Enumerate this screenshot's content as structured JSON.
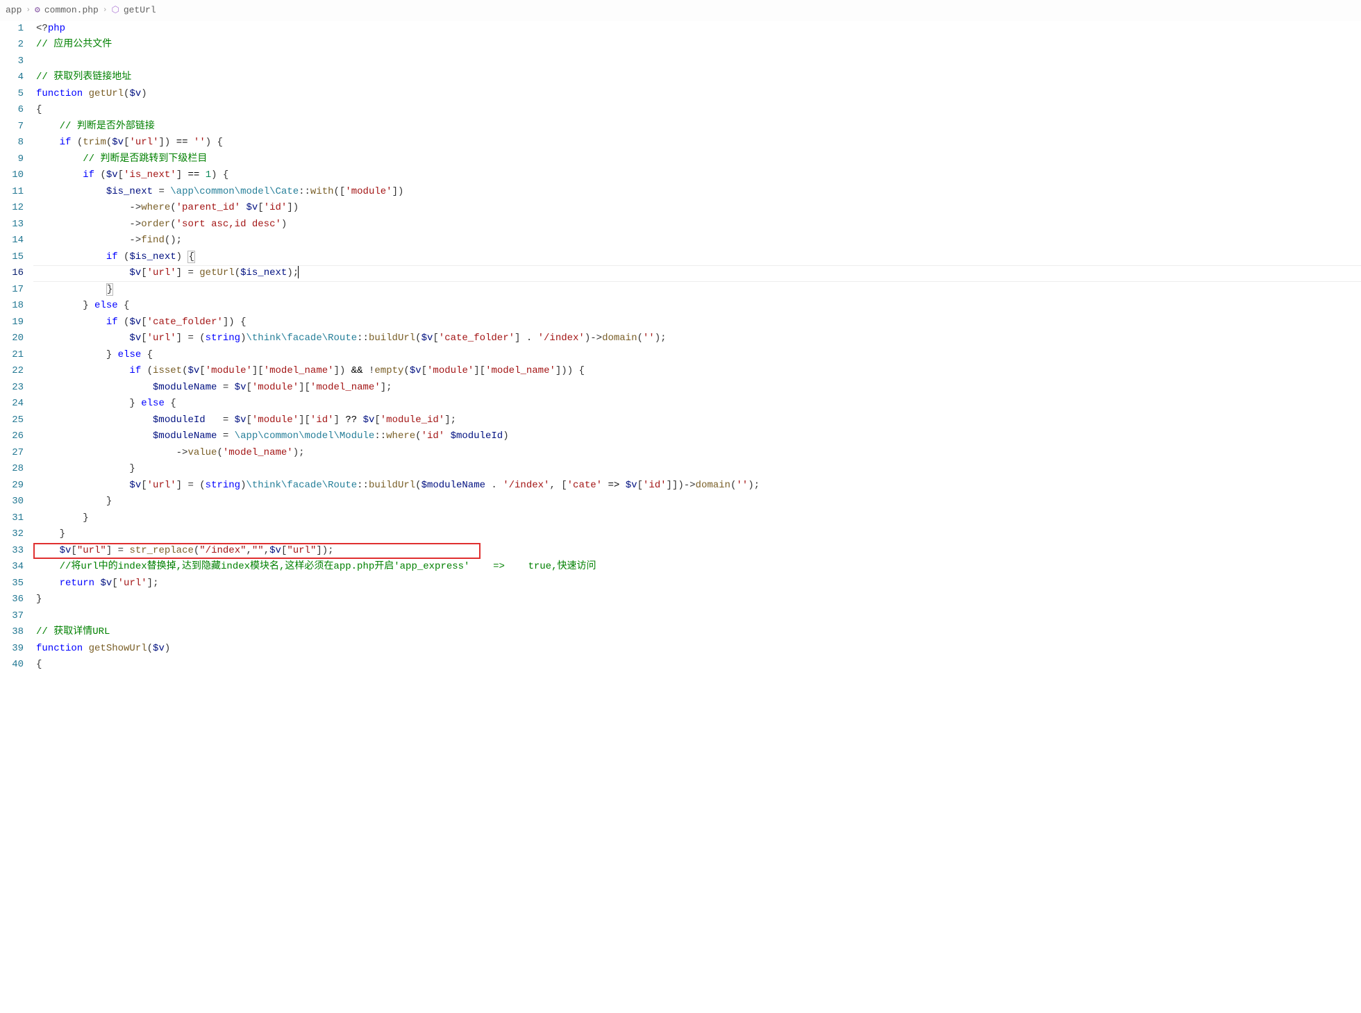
{
  "breadcrumb": {
    "root": "app",
    "file": "common.php",
    "symbol": "getUrl"
  },
  "active_line": 16,
  "highlighted_line": 33,
  "lines": [
    {
      "n": 1,
      "tokens": [
        [
          "tok-delim",
          "<?"
        ],
        [
          "tok-kw",
          "php"
        ]
      ]
    },
    {
      "n": 2,
      "tokens": [
        [
          "tok-cmt",
          "// 应用公共文件"
        ]
      ]
    },
    {
      "n": 3,
      "tokens": []
    },
    {
      "n": 4,
      "tokens": [
        [
          "tok-cmt",
          "// 获取列表链接地址"
        ]
      ]
    },
    {
      "n": 5,
      "tokens": [
        [
          "tok-kw",
          "function"
        ],
        [
          "",
          ", "
        ],
        [
          "tok-fn",
          "getUrl"
        ],
        [
          "tok-delim",
          "("
        ],
        [
          "tok-var",
          "$v"
        ],
        [
          "tok-delim",
          ")"
        ]
      ]
    },
    {
      "n": 6,
      "tokens": [
        [
          "tok-delim",
          "{"
        ]
      ]
    },
    {
      "n": 7,
      "tokens": [
        [
          "",
          "    "
        ],
        [
          "tok-cmt",
          "// 判断是否外部链接"
        ]
      ]
    },
    {
      "n": 8,
      "tokens": [
        [
          "",
          "    "
        ],
        [
          "tok-kw",
          "if"
        ],
        [
          "",
          " ("
        ],
        [
          "tok-fn",
          "trim"
        ],
        [
          "tok-delim",
          "("
        ],
        [
          "tok-var",
          "$v"
        ],
        [
          "tok-delim",
          "["
        ],
        [
          "tok-str",
          "'url'"
        ],
        [
          "tok-delim",
          "]) "
        ],
        [
          "tok-op",
          "=="
        ],
        [
          "",
          " "
        ],
        [
          "tok-str",
          "''"
        ],
        [
          "tok-delim",
          ") {"
        ]
      ]
    },
    {
      "n": 9,
      "tokens": [
        [
          "",
          "        "
        ],
        [
          "tok-cmt",
          "// 判断是否跳转到下级栏目"
        ]
      ]
    },
    {
      "n": 10,
      "tokens": [
        [
          "",
          "        "
        ],
        [
          "tok-kw",
          "if"
        ],
        [
          "",
          " ("
        ],
        [
          "tok-var",
          "$v"
        ],
        [
          "tok-delim",
          "["
        ],
        [
          "tok-str",
          "'is_next'"
        ],
        [
          "tok-delim",
          "] "
        ],
        [
          "tok-op",
          "=="
        ],
        [
          "",
          " "
        ],
        [
          "tok-num",
          "1"
        ],
        [
          "tok-delim",
          ") {"
        ]
      ]
    },
    {
      "n": 11,
      "tokens": [
        [
          "",
          "            "
        ],
        [
          "tok-var",
          "$is_next"
        ],
        [
          "",
          " = "
        ],
        [
          "tok-ns",
          "\\app\\common\\model\\"
        ],
        [
          "tok-cls",
          "Cate"
        ],
        [
          "tok-delim",
          "::"
        ],
        [
          "tok-fn",
          "with"
        ],
        [
          "tok-delim",
          "(["
        ],
        [
          "tok-str",
          "'module'"
        ],
        [
          "tok-delim",
          "])"
        ]
      ]
    },
    {
      "n": 12,
      "tokens": [
        [
          "",
          "                "
        ],
        [
          "tok-delim",
          "->"
        ],
        [
          "tok-fn",
          "where"
        ],
        [
          "tok-delim",
          "("
        ],
        [
          "tok-str",
          "'parent_id'"
        ],
        [
          "tok-delim",
          ", "
        ],
        [
          "tok-var",
          "$v"
        ],
        [
          "tok-delim",
          "["
        ],
        [
          "tok-str",
          "'id'"
        ],
        [
          "tok-delim",
          "])"
        ]
      ]
    },
    {
      "n": 13,
      "tokens": [
        [
          "",
          "                "
        ],
        [
          "tok-delim",
          "->"
        ],
        [
          "tok-fn",
          "order"
        ],
        [
          "tok-delim",
          "("
        ],
        [
          "tok-str",
          "'sort asc,id desc'"
        ],
        [
          "tok-delim",
          ")"
        ]
      ]
    },
    {
      "n": 14,
      "tokens": [
        [
          "",
          "                "
        ],
        [
          "tok-delim",
          "->"
        ],
        [
          "tok-fn",
          "find"
        ],
        [
          "tok-delim",
          "();"
        ]
      ]
    },
    {
      "n": 15,
      "tokens": [
        [
          "",
          "            "
        ],
        [
          "tok-kw",
          "if"
        ],
        [
          "",
          " ("
        ],
        [
          "tok-var",
          "$is_next"
        ],
        [
          "tok-delim",
          ") "
        ],
        [
          "tok-delim bracket-match",
          "{"
        ]
      ]
    },
    {
      "n": 16,
      "tokens": [
        [
          "",
          "                "
        ],
        [
          "tok-var",
          "$v"
        ],
        [
          "tok-delim",
          "["
        ],
        [
          "tok-str",
          "'url'"
        ],
        [
          "tok-delim",
          "] = "
        ],
        [
          "tok-fn",
          "getUrl"
        ],
        [
          "tok-delim",
          "("
        ],
        [
          "tok-var",
          "$is_next"
        ],
        [
          "tok-delim",
          ");"
        ]
      ]
    },
    {
      "n": 17,
      "tokens": [
        [
          "",
          "            "
        ],
        [
          "tok-delim bracket-match",
          "}"
        ]
      ]
    },
    {
      "n": 18,
      "tokens": [
        [
          "",
          "        "
        ],
        [
          "tok-delim",
          "} "
        ],
        [
          "tok-kw",
          "else"
        ],
        [
          "tok-delim",
          " {"
        ]
      ]
    },
    {
      "n": 19,
      "tokens": [
        [
          "",
          "            "
        ],
        [
          "tok-kw",
          "if"
        ],
        [
          "",
          " ("
        ],
        [
          "tok-var",
          "$v"
        ],
        [
          "tok-delim",
          "["
        ],
        [
          "tok-str",
          "'cate_folder'"
        ],
        [
          "tok-delim",
          "]) {"
        ]
      ]
    },
    {
      "n": 20,
      "tokens": [
        [
          "",
          "                "
        ],
        [
          "tok-var",
          "$v"
        ],
        [
          "tok-delim",
          "["
        ],
        [
          "tok-str",
          "'url'"
        ],
        [
          "tok-delim",
          "] = ("
        ],
        [
          "tok-kw",
          "string"
        ],
        [
          "tok-delim",
          ")"
        ],
        [
          "tok-ns",
          "\\think\\facade\\"
        ],
        [
          "tok-cls",
          "Route"
        ],
        [
          "tok-delim",
          "::"
        ],
        [
          "tok-fn",
          "buildUrl"
        ],
        [
          "tok-delim",
          "("
        ],
        [
          "tok-var",
          "$v"
        ],
        [
          "tok-delim",
          "["
        ],
        [
          "tok-str",
          "'cate_folder'"
        ],
        [
          "tok-delim",
          "] . "
        ],
        [
          "tok-str",
          "'/index'"
        ],
        [
          "tok-delim",
          ")->"
        ],
        [
          "tok-fn",
          "domain"
        ],
        [
          "tok-delim",
          "("
        ],
        [
          "tok-str",
          "''"
        ],
        [
          "tok-delim",
          ");"
        ]
      ]
    },
    {
      "n": 21,
      "tokens": [
        [
          "",
          "            "
        ],
        [
          "tok-delim",
          "} "
        ],
        [
          "tok-kw",
          "else"
        ],
        [
          "tok-delim",
          " {"
        ]
      ]
    },
    {
      "n": 22,
      "tokens": [
        [
          "",
          "                "
        ],
        [
          "tok-kw",
          "if"
        ],
        [
          "",
          " ("
        ],
        [
          "tok-fn",
          "isset"
        ],
        [
          "tok-delim",
          "("
        ],
        [
          "tok-var",
          "$v"
        ],
        [
          "tok-delim",
          "["
        ],
        [
          "tok-str",
          "'module'"
        ],
        [
          "tok-delim",
          "]["
        ],
        [
          "tok-str",
          "'model_name'"
        ],
        [
          "tok-delim",
          "]) "
        ],
        [
          "tok-op",
          "&&"
        ],
        [
          "",
          " !"
        ],
        [
          "tok-fn",
          "empty"
        ],
        [
          "tok-delim",
          "("
        ],
        [
          "tok-var",
          "$v"
        ],
        [
          "tok-delim",
          "["
        ],
        [
          "tok-str",
          "'module'"
        ],
        [
          "tok-delim",
          "]["
        ],
        [
          "tok-str",
          "'model_name'"
        ],
        [
          "tok-delim",
          "])) {"
        ]
      ]
    },
    {
      "n": 23,
      "tokens": [
        [
          "",
          "                    "
        ],
        [
          "tok-var",
          "$moduleName"
        ],
        [
          "",
          " = "
        ],
        [
          "tok-var",
          "$v"
        ],
        [
          "tok-delim",
          "["
        ],
        [
          "tok-str",
          "'module'"
        ],
        [
          "tok-delim",
          "]["
        ],
        [
          "tok-str",
          "'model_name'"
        ],
        [
          "tok-delim",
          "];"
        ]
      ]
    },
    {
      "n": 24,
      "tokens": [
        [
          "",
          "                "
        ],
        [
          "tok-delim",
          "} "
        ],
        [
          "tok-kw",
          "else"
        ],
        [
          "tok-delim",
          " {"
        ]
      ]
    },
    {
      "n": 25,
      "tokens": [
        [
          "",
          "                    "
        ],
        [
          "tok-var",
          "$moduleId"
        ],
        [
          "",
          "   = "
        ],
        [
          "tok-var",
          "$v"
        ],
        [
          "tok-delim",
          "["
        ],
        [
          "tok-str",
          "'module'"
        ],
        [
          "tok-delim",
          "]["
        ],
        [
          "tok-str",
          "'id'"
        ],
        [
          "tok-delim",
          "] "
        ],
        [
          "tok-op",
          "??"
        ],
        [
          "",
          " "
        ],
        [
          "tok-var",
          "$v"
        ],
        [
          "tok-delim",
          "["
        ],
        [
          "tok-str",
          "'module_id'"
        ],
        [
          "tok-delim",
          "];"
        ]
      ]
    },
    {
      "n": 26,
      "tokens": [
        [
          "",
          "                    "
        ],
        [
          "tok-var",
          "$moduleName"
        ],
        [
          "",
          " = "
        ],
        [
          "tok-ns",
          "\\app\\common\\model\\"
        ],
        [
          "tok-cls",
          "Module"
        ],
        [
          "tok-delim",
          "::"
        ],
        [
          "tok-fn",
          "where"
        ],
        [
          "tok-delim",
          "("
        ],
        [
          "tok-str",
          "'id'"
        ],
        [
          "tok-delim",
          ", "
        ],
        [
          "tok-var",
          "$moduleId"
        ],
        [
          "tok-delim",
          ")"
        ]
      ]
    },
    {
      "n": 27,
      "tokens": [
        [
          "",
          "                        "
        ],
        [
          "tok-delim",
          "->"
        ],
        [
          "tok-fn",
          "value"
        ],
        [
          "tok-delim",
          "("
        ],
        [
          "tok-str",
          "'model_name'"
        ],
        [
          "tok-delim",
          ");"
        ]
      ]
    },
    {
      "n": 28,
      "tokens": [
        [
          "",
          "                "
        ],
        [
          "tok-delim",
          "}"
        ]
      ]
    },
    {
      "n": 29,
      "tokens": [
        [
          "",
          "                "
        ],
        [
          "tok-var",
          "$v"
        ],
        [
          "tok-delim",
          "["
        ],
        [
          "tok-str",
          "'url'"
        ],
        [
          "tok-delim",
          "] = ("
        ],
        [
          "tok-kw",
          "string"
        ],
        [
          "tok-delim",
          ")"
        ],
        [
          "tok-ns",
          "\\think\\facade\\"
        ],
        [
          "tok-cls",
          "Route"
        ],
        [
          "tok-delim",
          "::"
        ],
        [
          "tok-fn",
          "buildUrl"
        ],
        [
          "tok-delim",
          "("
        ],
        [
          "tok-var",
          "$moduleName"
        ],
        [
          "",
          " . "
        ],
        [
          "tok-str",
          "'/index'"
        ],
        [
          "tok-delim",
          ", ["
        ],
        [
          "tok-str",
          "'cate'"
        ],
        [
          "",
          " "
        ],
        [
          "tok-op",
          "=>"
        ],
        [
          "",
          " "
        ],
        [
          "tok-var",
          "$v"
        ],
        [
          "tok-delim",
          "["
        ],
        [
          "tok-str",
          "'id'"
        ],
        [
          "tok-delim",
          "]])->"
        ],
        [
          "tok-fn",
          "domain"
        ],
        [
          "tok-delim",
          "("
        ],
        [
          "tok-str",
          "''"
        ],
        [
          "tok-delim",
          ");"
        ]
      ]
    },
    {
      "n": 30,
      "tokens": [
        [
          "",
          "            "
        ],
        [
          "tok-delim",
          "}"
        ]
      ]
    },
    {
      "n": 31,
      "tokens": [
        [
          "",
          "        "
        ],
        [
          "tok-delim",
          "}"
        ]
      ]
    },
    {
      "n": 32,
      "tokens": [
        [
          "",
          "    "
        ],
        [
          "tok-delim",
          "}"
        ]
      ]
    },
    {
      "n": 33,
      "tokens": [
        [
          "",
          "    "
        ],
        [
          "tok-var",
          "$v"
        ],
        [
          "tok-delim",
          "["
        ],
        [
          "tok-str",
          "\"url\""
        ],
        [
          "tok-delim",
          "] = "
        ],
        [
          "tok-fn",
          "str_replace"
        ],
        [
          "tok-delim",
          "("
        ],
        [
          "tok-str",
          "\"/index\""
        ],
        [
          "tok-delim",
          ","
        ],
        [
          "tok-str",
          "\"\""
        ],
        [
          "tok-delim",
          ","
        ],
        [
          "tok-var",
          "$v"
        ],
        [
          "tok-delim",
          "["
        ],
        [
          "tok-str",
          "\"url\""
        ],
        [
          "tok-delim",
          "]);"
        ]
      ]
    },
    {
      "n": 34,
      "tokens": [
        [
          "",
          "    "
        ],
        [
          "tok-cmt",
          "//将url中的index替换掉,达到隐藏index模块名,这样必须在app.php开启'app_express'    =>    true,快速访问"
        ]
      ]
    },
    {
      "n": 35,
      "tokens": [
        [
          "",
          "    "
        ],
        [
          "tok-kw",
          "return"
        ],
        [
          "",
          " "
        ],
        [
          "tok-var",
          "$v"
        ],
        [
          "tok-delim",
          "["
        ],
        [
          "tok-str",
          "'url'"
        ],
        [
          "tok-delim",
          "];"
        ]
      ]
    },
    {
      "n": 36,
      "tokens": [
        [
          "tok-delim",
          "}"
        ]
      ]
    },
    {
      "n": 37,
      "tokens": []
    },
    {
      "n": 38,
      "tokens": [
        [
          "tok-cmt",
          "// 获取详情URL"
        ]
      ]
    },
    {
      "n": 39,
      "tokens": [
        [
          "tok-kw",
          "function"
        ],
        [
          "",
          " "
        ],
        [
          "tok-fn",
          "getShowUrl"
        ],
        [
          "tok-delim",
          "("
        ],
        [
          "tok-var",
          "$v"
        ],
        [
          "tok-delim",
          ")"
        ]
      ]
    },
    {
      "n": 40,
      "tokens": [
        [
          "tok-delim",
          "{"
        ]
      ]
    }
  ]
}
